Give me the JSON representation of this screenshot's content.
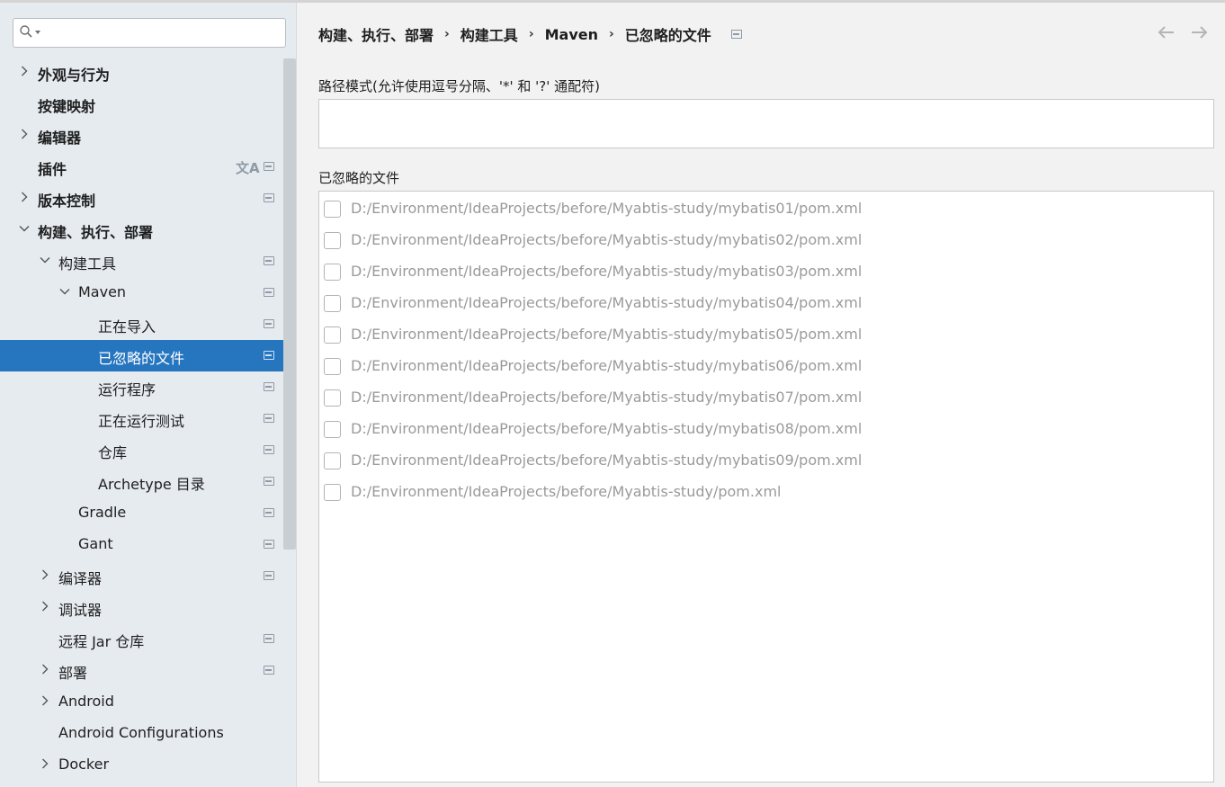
{
  "search": {
    "placeholder": "",
    "value": ""
  },
  "sidebar": {
    "items": [
      {
        "label": "外观与行为",
        "bold": true,
        "expandable": true,
        "expanded": false,
        "indent": 0,
        "project": false
      },
      {
        "label": "按键映射",
        "bold": true,
        "expandable": false,
        "indent": 0,
        "project": false
      },
      {
        "label": "编辑器",
        "bold": true,
        "expandable": true,
        "expanded": false,
        "indent": 0,
        "project": false
      },
      {
        "label": "插件",
        "bold": true,
        "expandable": false,
        "indent": 0,
        "project": true,
        "translate": true
      },
      {
        "label": "版本控制",
        "bold": true,
        "expandable": true,
        "expanded": false,
        "indent": 0,
        "project": true
      },
      {
        "label": "构建、执行、部署",
        "bold": true,
        "expandable": true,
        "expanded": true,
        "indent": 0,
        "project": false
      },
      {
        "label": "构建工具",
        "bold": false,
        "expandable": true,
        "expanded": true,
        "indent": 1,
        "project": true
      },
      {
        "label": "Maven",
        "bold": false,
        "expandable": true,
        "expanded": true,
        "indent": 2,
        "project": true
      },
      {
        "label": "正在导入",
        "bold": false,
        "expandable": false,
        "indent": 3,
        "project": true
      },
      {
        "label": "已忽略的文件",
        "bold": false,
        "expandable": false,
        "indent": 3,
        "project": true,
        "selected": true
      },
      {
        "label": "运行程序",
        "bold": false,
        "expandable": false,
        "indent": 3,
        "project": true
      },
      {
        "label": "正在运行测试",
        "bold": false,
        "expandable": false,
        "indent": 3,
        "project": true
      },
      {
        "label": "仓库",
        "bold": false,
        "expandable": false,
        "indent": 3,
        "project": true
      },
      {
        "label": "Archetype 目录",
        "bold": false,
        "expandable": false,
        "indent": 3,
        "project": true
      },
      {
        "label": "Gradle",
        "bold": false,
        "expandable": false,
        "indent": 2,
        "project": true
      },
      {
        "label": "Gant",
        "bold": false,
        "expandable": false,
        "indent": 2,
        "project": true
      },
      {
        "label": "编译器",
        "bold": false,
        "expandable": true,
        "expanded": false,
        "indent": 1,
        "project": true
      },
      {
        "label": "调试器",
        "bold": false,
        "expandable": true,
        "expanded": false,
        "indent": 1,
        "project": false
      },
      {
        "label": "远程 Jar 仓库",
        "bold": false,
        "expandable": false,
        "indent": 1,
        "project": true
      },
      {
        "label": "部署",
        "bold": false,
        "expandable": true,
        "expanded": false,
        "indent": 1,
        "project": true
      },
      {
        "label": "Android",
        "bold": false,
        "expandable": true,
        "expanded": false,
        "indent": 1,
        "project": false
      },
      {
        "label": "Android Configurations",
        "bold": false,
        "expandable": false,
        "indent": 1,
        "project": false
      },
      {
        "label": "Docker",
        "bold": false,
        "expandable": true,
        "expanded": false,
        "indent": 1,
        "project": false
      }
    ]
  },
  "breadcrumb": [
    "构建、执行、部署",
    "构建工具",
    "Maven",
    "已忽略的文件"
  ],
  "path_pattern": {
    "label": "路径模式(允许使用逗号分隔、'*' 和 '?' 通配符)",
    "value": ""
  },
  "ignored_files": {
    "label": "已忽略的文件",
    "items": [
      {
        "path": "D:/Environment/IdeaProjects/before/Myabtis-study/mybatis01/pom.xml",
        "checked": false
      },
      {
        "path": "D:/Environment/IdeaProjects/before/Myabtis-study/mybatis02/pom.xml",
        "checked": false
      },
      {
        "path": "D:/Environment/IdeaProjects/before/Myabtis-study/mybatis03/pom.xml",
        "checked": false
      },
      {
        "path": "D:/Environment/IdeaProjects/before/Myabtis-study/mybatis04/pom.xml",
        "checked": false
      },
      {
        "path": "D:/Environment/IdeaProjects/before/Myabtis-study/mybatis05/pom.xml",
        "checked": false
      },
      {
        "path": "D:/Environment/IdeaProjects/before/Myabtis-study/mybatis06/pom.xml",
        "checked": false
      },
      {
        "path": "D:/Environment/IdeaProjects/before/Myabtis-study/mybatis07/pom.xml",
        "checked": false
      },
      {
        "path": "D:/Environment/IdeaProjects/before/Myabtis-study/mybatis08/pom.xml",
        "checked": false
      },
      {
        "path": "D:/Environment/IdeaProjects/before/Myabtis-study/mybatis09/pom.xml",
        "checked": false
      },
      {
        "path": "D:/Environment/IdeaProjects/before/Myabtis-study/pom.xml",
        "checked": false
      }
    ]
  },
  "colors": {
    "selection": "#2675bf",
    "sidebar_bg": "#e6ebf0",
    "disabled_text": "#9a9a9a"
  }
}
